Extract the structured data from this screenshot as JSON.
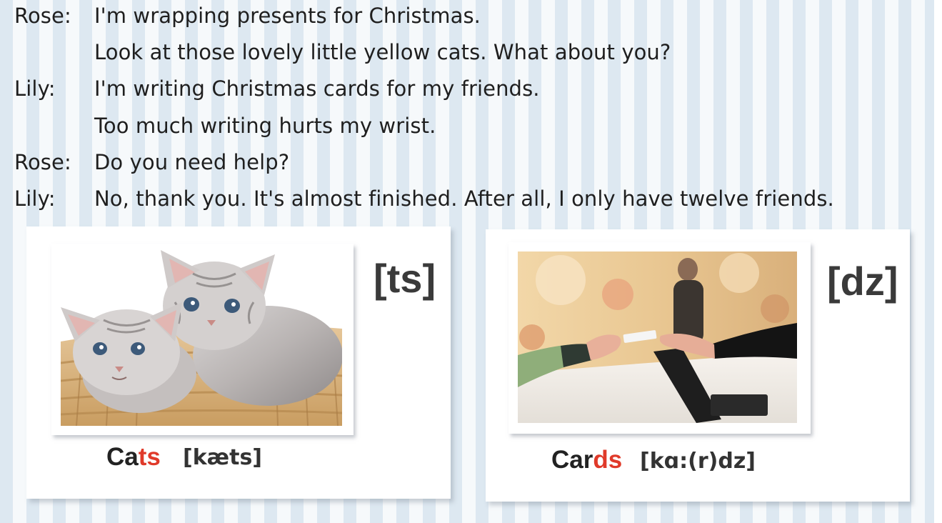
{
  "dialogue": [
    {
      "speaker": "Rose:",
      "text": "I'm wrapping presents for Christmas."
    },
    {
      "speaker": "",
      "text": "Look at those lovely little yellow cats. What about you?"
    },
    {
      "speaker": "Lily:",
      "text": "I'm writing Christmas cards for my friends."
    },
    {
      "speaker": "",
      "text": "Too much writing hurts my wrist."
    },
    {
      "speaker": "Rose:",
      "text": "Do you need help?"
    },
    {
      "speaker": "Lily:",
      "text": "No, thank you. It's almost finished. After all, I only have twelve friends."
    }
  ],
  "cards": [
    {
      "sound": "[ts]",
      "word_base": "Ca",
      "word_ending": "ts",
      "phonetic": "[kæts]",
      "image": "kittens-in-basket"
    },
    {
      "sound": "[dz]",
      "word_base": "Car",
      "word_ending": "ds",
      "phonetic": "[kɑ:(r)dz]",
      "image": "card-handover-at-counter"
    }
  ],
  "colors": {
    "highlight": "#e03a2a",
    "stripe": "#dde8f1",
    "background": "#f6f9fb"
  }
}
